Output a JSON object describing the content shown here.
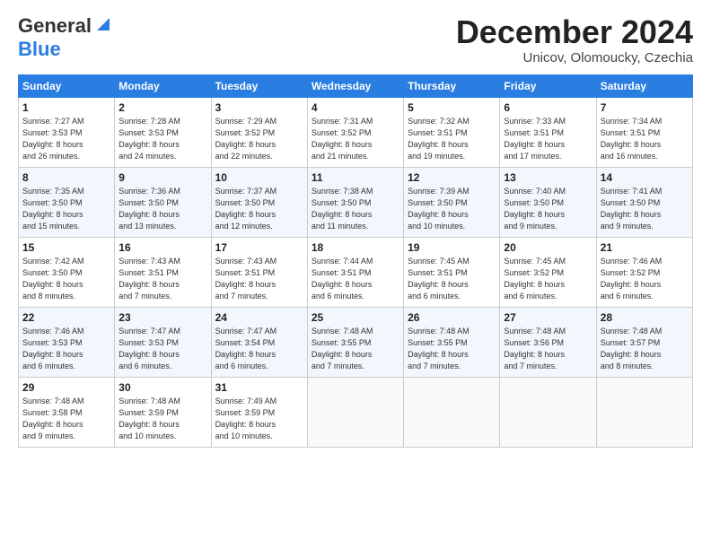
{
  "logo": {
    "line1": "General",
    "line2": "Blue"
  },
  "header": {
    "title": "December 2024",
    "subtitle": "Unicov, Olomoucky, Czechia"
  },
  "weekdays": [
    "Sunday",
    "Monday",
    "Tuesday",
    "Wednesday",
    "Thursday",
    "Friday",
    "Saturday"
  ],
  "weeks": [
    [
      {
        "day": "1",
        "info": "Sunrise: 7:27 AM\nSunset: 3:53 PM\nDaylight: 8 hours\nand 26 minutes."
      },
      {
        "day": "2",
        "info": "Sunrise: 7:28 AM\nSunset: 3:53 PM\nDaylight: 8 hours\nand 24 minutes."
      },
      {
        "day": "3",
        "info": "Sunrise: 7:29 AM\nSunset: 3:52 PM\nDaylight: 8 hours\nand 22 minutes."
      },
      {
        "day": "4",
        "info": "Sunrise: 7:31 AM\nSunset: 3:52 PM\nDaylight: 8 hours\nand 21 minutes."
      },
      {
        "day": "5",
        "info": "Sunrise: 7:32 AM\nSunset: 3:51 PM\nDaylight: 8 hours\nand 19 minutes."
      },
      {
        "day": "6",
        "info": "Sunrise: 7:33 AM\nSunset: 3:51 PM\nDaylight: 8 hours\nand 17 minutes."
      },
      {
        "day": "7",
        "info": "Sunrise: 7:34 AM\nSunset: 3:51 PM\nDaylight: 8 hours\nand 16 minutes."
      }
    ],
    [
      {
        "day": "8",
        "info": "Sunrise: 7:35 AM\nSunset: 3:50 PM\nDaylight: 8 hours\nand 15 minutes."
      },
      {
        "day": "9",
        "info": "Sunrise: 7:36 AM\nSunset: 3:50 PM\nDaylight: 8 hours\nand 13 minutes."
      },
      {
        "day": "10",
        "info": "Sunrise: 7:37 AM\nSunset: 3:50 PM\nDaylight: 8 hours\nand 12 minutes."
      },
      {
        "day": "11",
        "info": "Sunrise: 7:38 AM\nSunset: 3:50 PM\nDaylight: 8 hours\nand 11 minutes."
      },
      {
        "day": "12",
        "info": "Sunrise: 7:39 AM\nSunset: 3:50 PM\nDaylight: 8 hours\nand 10 minutes."
      },
      {
        "day": "13",
        "info": "Sunrise: 7:40 AM\nSunset: 3:50 PM\nDaylight: 8 hours\nand 9 minutes."
      },
      {
        "day": "14",
        "info": "Sunrise: 7:41 AM\nSunset: 3:50 PM\nDaylight: 8 hours\nand 9 minutes."
      }
    ],
    [
      {
        "day": "15",
        "info": "Sunrise: 7:42 AM\nSunset: 3:50 PM\nDaylight: 8 hours\nand 8 minutes."
      },
      {
        "day": "16",
        "info": "Sunrise: 7:43 AM\nSunset: 3:51 PM\nDaylight: 8 hours\nand 7 minutes."
      },
      {
        "day": "17",
        "info": "Sunrise: 7:43 AM\nSunset: 3:51 PM\nDaylight: 8 hours\nand 7 minutes."
      },
      {
        "day": "18",
        "info": "Sunrise: 7:44 AM\nSunset: 3:51 PM\nDaylight: 8 hours\nand 6 minutes."
      },
      {
        "day": "19",
        "info": "Sunrise: 7:45 AM\nSunset: 3:51 PM\nDaylight: 8 hours\nand 6 minutes."
      },
      {
        "day": "20",
        "info": "Sunrise: 7:45 AM\nSunset: 3:52 PM\nDaylight: 8 hours\nand 6 minutes."
      },
      {
        "day": "21",
        "info": "Sunrise: 7:46 AM\nSunset: 3:52 PM\nDaylight: 8 hours\nand 6 minutes."
      }
    ],
    [
      {
        "day": "22",
        "info": "Sunrise: 7:46 AM\nSunset: 3:53 PM\nDaylight: 8 hours\nand 6 minutes."
      },
      {
        "day": "23",
        "info": "Sunrise: 7:47 AM\nSunset: 3:53 PM\nDaylight: 8 hours\nand 6 minutes."
      },
      {
        "day": "24",
        "info": "Sunrise: 7:47 AM\nSunset: 3:54 PM\nDaylight: 8 hours\nand 6 minutes."
      },
      {
        "day": "25",
        "info": "Sunrise: 7:48 AM\nSunset: 3:55 PM\nDaylight: 8 hours\nand 7 minutes."
      },
      {
        "day": "26",
        "info": "Sunrise: 7:48 AM\nSunset: 3:55 PM\nDaylight: 8 hours\nand 7 minutes."
      },
      {
        "day": "27",
        "info": "Sunrise: 7:48 AM\nSunset: 3:56 PM\nDaylight: 8 hours\nand 7 minutes."
      },
      {
        "day": "28",
        "info": "Sunrise: 7:48 AM\nSunset: 3:57 PM\nDaylight: 8 hours\nand 8 minutes."
      }
    ],
    [
      {
        "day": "29",
        "info": "Sunrise: 7:48 AM\nSunset: 3:58 PM\nDaylight: 8 hours\nand 9 minutes."
      },
      {
        "day": "30",
        "info": "Sunrise: 7:48 AM\nSunset: 3:59 PM\nDaylight: 8 hours\nand 10 minutes."
      },
      {
        "day": "31",
        "info": "Sunrise: 7:49 AM\nSunset: 3:59 PM\nDaylight: 8 hours\nand 10 minutes."
      },
      null,
      null,
      null,
      null
    ]
  ]
}
